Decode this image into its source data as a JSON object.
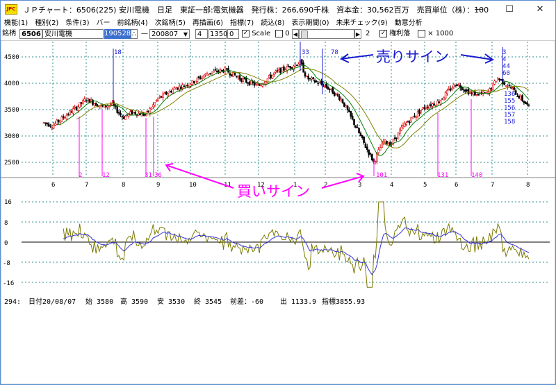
{
  "window": {
    "icon_label": "JPC",
    "title": "ＪＰチャート：6506(225) 安川電機　日足　東証一部:電気機器　発行株：266,690千株　資本金：30,562百万　売買単位（株）：100",
    "minimize": "—",
    "maximize": "☐",
    "close": "✕"
  },
  "menu": [
    "機能(1)",
    "種別(2)",
    "条件(3)",
    "バー",
    "前銘柄(4)",
    "次銘柄(5)",
    "再描画(6)",
    "指標(7)",
    "読込(8)",
    "表示期間(0)",
    "未来チェック(9)",
    "動意分析"
  ],
  "toolbar": {
    "label": "銘柄",
    "code": "6506",
    "name": "安川電機",
    "highlighted": "190528",
    "dash": "—",
    "date": "200807",
    "value1": "4",
    "value2": "1350",
    "value3": "0",
    "scale_label": "Scale",
    "scale_checked": true,
    "zero_label": "0",
    "right_value": "2",
    "kenri_label": "権利落",
    "kenri_checked": true,
    "x1000_label": "× 1000"
  },
  "price_chart": {
    "y_ticks": [
      "4500",
      "4000",
      "3500",
      "3000",
      "2500"
    ],
    "x_ticks": [
      "6",
      "7",
      "8",
      "9",
      "10",
      "11",
      "12",
      "1",
      "2",
      "3",
      "4",
      "5",
      "6",
      "7",
      "8"
    ],
    "sell_signals_numbers": [
      "18",
      "33",
      "78"
    ],
    "sell_cluster": [
      "3",
      "4",
      "44",
      "60",
      "136",
      "155",
      "156",
      "157",
      "158"
    ],
    "buy_signals_numbers": [
      "2",
      "12",
      "31",
      "36",
      "101",
      "131",
      "140"
    ],
    "annotation_sell": "売りサイン",
    "annotation_buy": "買いサイン"
  },
  "osc_chart": {
    "y_ticks": [
      "16",
      "8",
      "0",
      "-8",
      "-16"
    ]
  },
  "status": {
    "index_label": "294:",
    "date": "日付20/08/07",
    "open": "始 3580",
    "high": "高 3590",
    "low": "安 3530",
    "close": "終 3545",
    "change": "前差：-60",
    "volume": "出 1133.9",
    "indicator": "指標3855.93"
  },
  "colors": {
    "bull": "#e00000",
    "bear": "#000000",
    "ma_short": "#008000",
    "ma_long": "#808000",
    "sell": "#1a1ad0",
    "buy": "#ff00ff",
    "grid": "#2f8f8f",
    "osc_fast": "#7a7a00",
    "osc_slow": "#3333dd"
  }
}
